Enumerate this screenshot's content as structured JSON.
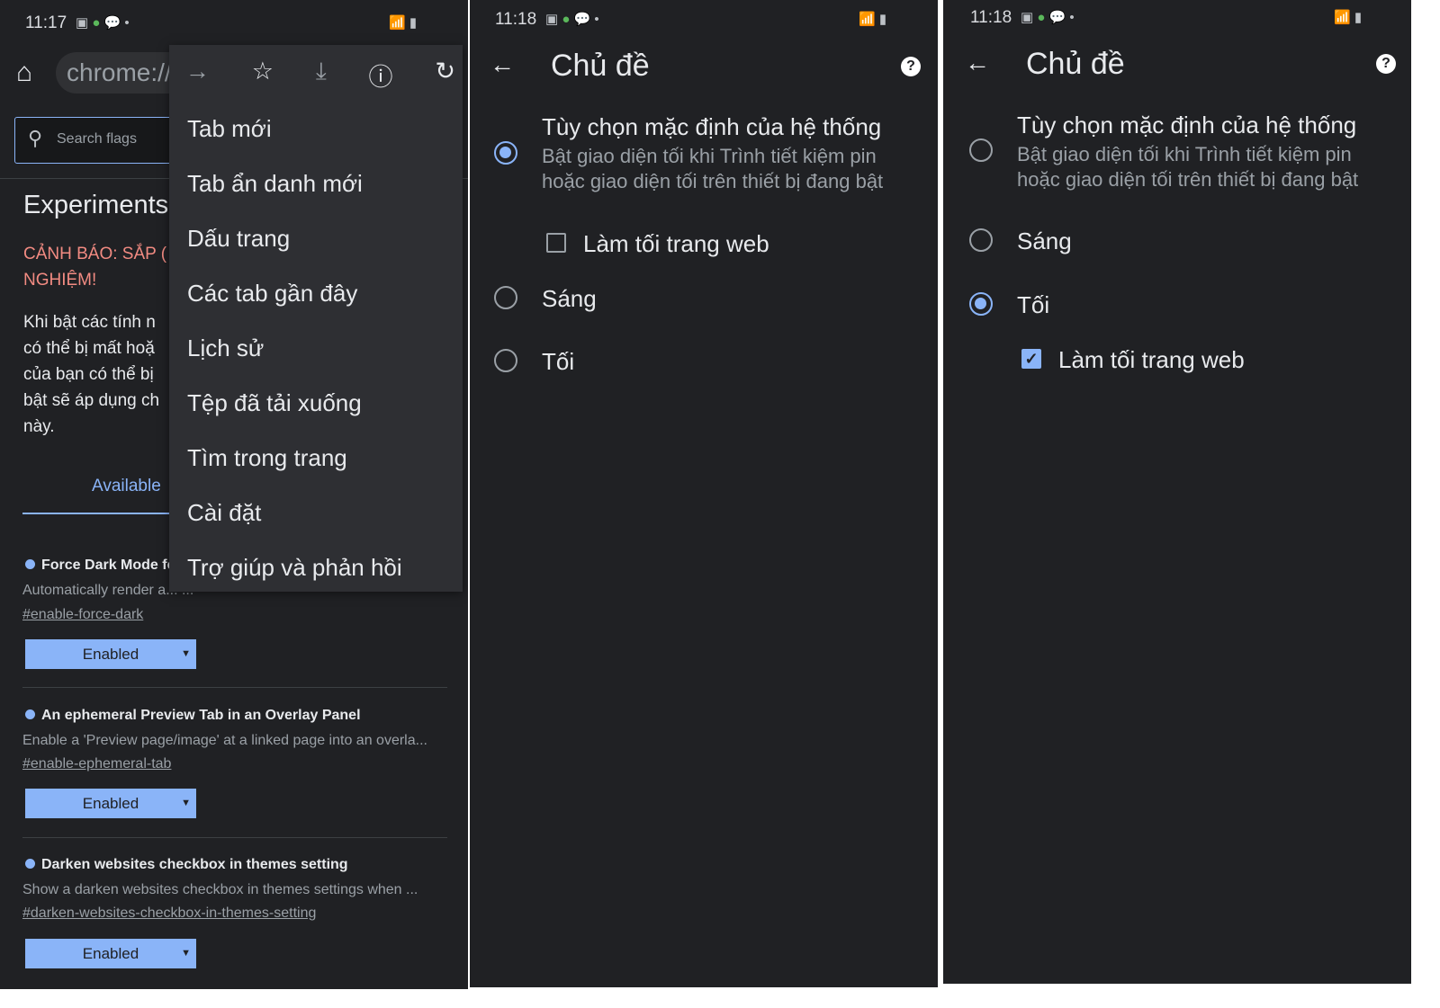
{
  "panel1": {
    "status": {
      "time": "11:17",
      "icons": [
        "image-icon",
        "app-icon",
        "chat-icon",
        "dot-icon",
        "wifi-icon",
        "signal-icon",
        "battery-icon"
      ]
    },
    "url": "chrome://",
    "search_placeholder": "Search flags",
    "heading": "Experiments",
    "warning": [
      "CẢNH BÁO: SẮP (",
      "NGHIỆM!"
    ],
    "intro": [
      "Khi bật các tính n",
      "có thể bị mất hoặ",
      "của bạn có thể bị",
      "bật sẽ áp dụng ch",
      "này."
    ],
    "tab_available": "Available",
    "menu": [
      "Tab mới",
      "Tab ẩn danh mới",
      "Dấu trang",
      "Các tab gần đây",
      "Lịch sử",
      "Tệp đã tải xuống",
      "Tìm trong trang",
      "Cài đặt",
      "Trợ giúp và phản hồi"
    ],
    "flags": [
      {
        "title": "Force Dark Mode fc",
        "desc": "Automatically render a... ...",
        "link": "#enable-force-dark",
        "value": "Enabled"
      },
      {
        "title": "An ephemeral Preview Tab in an Overlay Panel",
        "desc": "Enable a 'Preview page/image' at a linked page into an overla...",
        "link": "#enable-ephemeral-tab",
        "value": "Enabled"
      },
      {
        "title": "Darken websites checkbox in themes setting",
        "desc": "Show a darken websites checkbox in themes settings when ...",
        "link": "#darken-websites-checkbox-in-themes-setting",
        "value": "Enabled"
      }
    ]
  },
  "panel2": {
    "time": "11:18",
    "title": "Chủ đề",
    "system": "Tùy chọn mặc định của hệ thống",
    "system_desc": [
      "Bật giao diện tối khi Trình tiết kiệm pin",
      "hoặc giao diện tối trên thiết bị đang bật"
    ],
    "darken": "Làm tối trang web",
    "light": "Sáng",
    "dark": "Tối",
    "selected": "system",
    "darken_checked": false
  },
  "panel3": {
    "time": "11:18",
    "title": "Chủ đề",
    "system": "Tùy chọn mặc định của hệ thống",
    "system_desc": [
      "Bật giao diện tối khi Trình tiết kiệm pin",
      "hoặc giao diện tối trên thiết bị đang bật"
    ],
    "light": "Sáng",
    "dark": "Tối",
    "darken": "Làm tối trang web",
    "selected": "dark",
    "darken_checked": true
  },
  "help_glyph": "?",
  "back_glyph": "←",
  "colors": {
    "background": "#202124",
    "menu": "#2e2f33",
    "accent": "#8ab4f8",
    "warning": "#f28b82"
  }
}
